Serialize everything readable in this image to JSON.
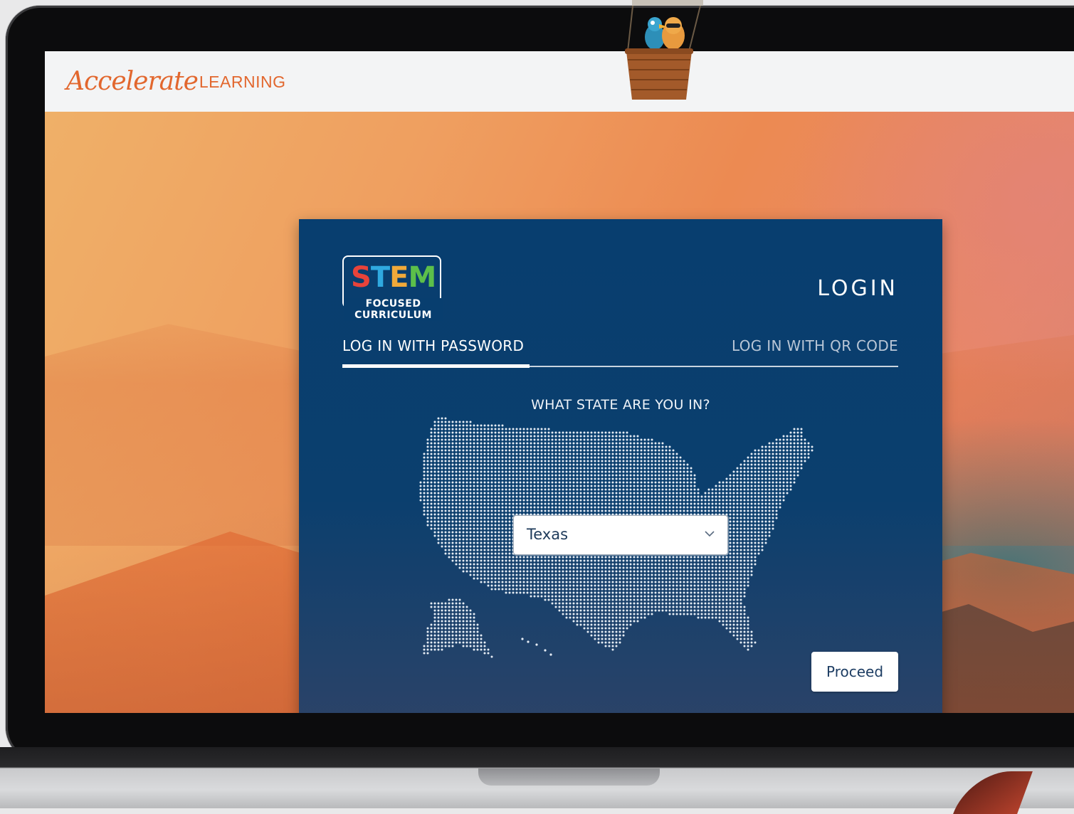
{
  "header": {
    "brand_script": "Accelerate",
    "brand_caps": "LEARNING"
  },
  "card": {
    "logo": {
      "word_letters": [
        {
          "ch": "S",
          "color": "#e8433a"
        },
        {
          "ch": "T",
          "color": "#2fa9e0"
        },
        {
          "ch": "E",
          "color": "#f0a93a"
        },
        {
          "ch": "M",
          "color": "#5cbf4a"
        }
      ],
      "sub_line1": "FOCUSED",
      "sub_line2": "CURRICULUM"
    },
    "title": "LOGIN",
    "tabs": {
      "password": "LOG IN WITH PASSWORD",
      "qr": "LOG IN WITH QR CODE",
      "active": "password"
    },
    "question": "WHAT STATE ARE YOU IN?",
    "state_select": {
      "value": "Texas"
    },
    "proceed_label": "Proceed"
  },
  "colors": {
    "brand_orange": "#e2672e",
    "card_blue": "#083e6f",
    "tab_inactive": "#b9c6d6"
  },
  "icons": {
    "map": "usa-dot-map-icon",
    "chevron": "chevron-down-icon",
    "mascot": "hot-air-balloon-mascot-icon"
  }
}
